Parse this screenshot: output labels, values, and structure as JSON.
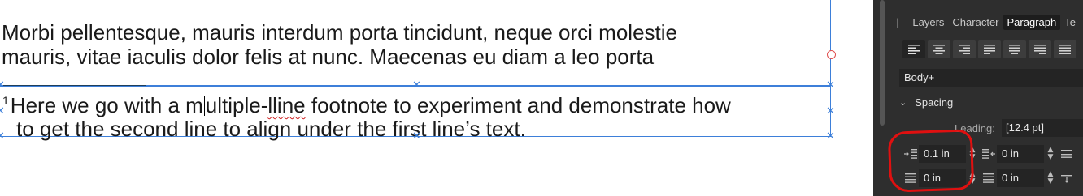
{
  "document": {
    "body_line1": "Morbi pellentesque, mauris interdum porta tincidunt, neque orci molestie",
    "body_line2": "mauris, vitae iaculis dolor felis at nunc. Maecenas eu diam a leo porta",
    "footnote": {
      "marker": "1",
      "line1_part1": "Here we go with a m",
      "line1_part2": "ultiple-",
      "line1_misspelled": "lline",
      "line1_part3": " footnote to experiment and demonstrate how",
      "line2": "to get the second line to align under the first line’s text."
    }
  },
  "panel": {
    "tabs": [
      {
        "label": "Layers"
      },
      {
        "label": "Character"
      },
      {
        "label": "Paragraph"
      },
      {
        "label": "Te"
      }
    ],
    "active_tab": "Paragraph",
    "alignment_buttons": [
      "align-left",
      "align-center",
      "align-right",
      "justify-left",
      "justify-center",
      "justify-right",
      "justify-all"
    ],
    "paragraph_style": "Body+",
    "spacing_section": "Spacing",
    "leading_label": "Leading:",
    "leading_value": "[12.4 pt]",
    "left_indent": "0.1 in",
    "right_indent": "0 in",
    "first_line_indent": "0 in",
    "space_before": "0 in",
    "annotation_color": "#e01010",
    "accent": "#3d7fd9"
  }
}
